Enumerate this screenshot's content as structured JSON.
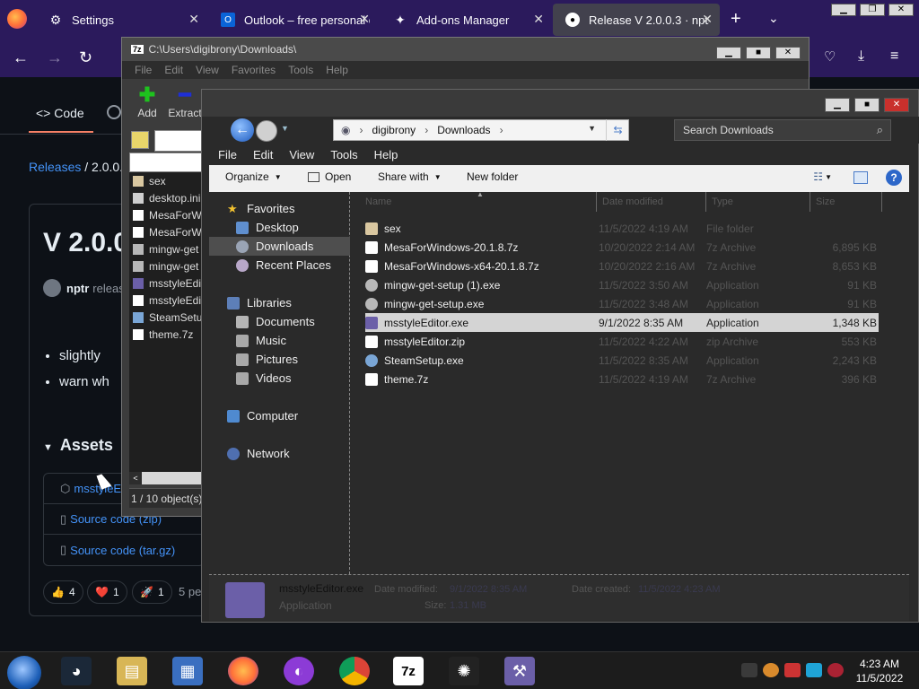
{
  "firefox": {
    "tabs": [
      {
        "label": "Settings",
        "icon": "gear-icon"
      },
      {
        "label": "Outlook – free personal e",
        "icon": "outlook-icon"
      },
      {
        "label": "Add-ons Manager",
        "icon": "puzzle-icon"
      },
      {
        "label": "Release V 2.0.0.3 · nptr/m",
        "icon": "github-icon"
      }
    ],
    "new_tab": "+",
    "list_tabs": "⌄"
  },
  "github": {
    "code_tab": "Code",
    "breadcrumb_link": "Releases",
    "breadcrumb_rest": "/ 2.0.0.3",
    "release_title": "V 2.0.0",
    "author": "nptr",
    "author_suffix": "releas",
    "bullets": [
      "slightly",
      "warn wh"
    ],
    "assets_heading": "Assets",
    "assets": [
      "msstyleE",
      "Source code (zip)",
      "Source code (tar.gz)"
    ],
    "reactions": [
      {
        "emoji": "👍",
        "count": "4"
      },
      {
        "emoji": "❤️",
        "count": "1"
      },
      {
        "emoji": "🚀",
        "count": "1"
      }
    ],
    "people": "5 pe"
  },
  "sevenzip": {
    "title": "C:\\Users\\digibrony\\Downloads\\",
    "menu": [
      "File",
      "Edit",
      "View",
      "Favorites",
      "Tools",
      "Help"
    ],
    "tools": [
      "Add",
      "Extract"
    ],
    "items": [
      "sex",
      "desktop.ini",
      "MesaForW",
      "MesaForW",
      "mingw-get",
      "mingw-get",
      "msstyleEdi",
      "msstyleEdi",
      "SteamSetu",
      "theme.7z"
    ],
    "status": "1 / 10 object(s)"
  },
  "explorer": {
    "address": [
      "digibrony",
      "Downloads"
    ],
    "search_placeholder": "Search Downloads",
    "menu": [
      "File",
      "Edit",
      "View",
      "Tools",
      "Help"
    ],
    "commands": {
      "organize": "Organize",
      "open": "Open",
      "share": "Share with",
      "new_folder": "New folder"
    },
    "nav": {
      "favorites": "Favorites",
      "desktop": "Desktop",
      "downloads": "Downloads",
      "recent": "Recent Places",
      "libraries": "Libraries",
      "documents": "Documents",
      "music": "Music",
      "pictures": "Pictures",
      "videos": "Videos",
      "computer": "Computer",
      "network": "Network"
    },
    "columns": [
      "Name",
      "Date modified",
      "Type",
      "Size"
    ],
    "files": [
      {
        "name": "sex",
        "date": "11/5/2022 4:19 AM",
        "type": "File folder",
        "size": ""
      },
      {
        "name": "MesaForWindows-20.1.8.7z",
        "date": "10/20/2022 2:14 AM",
        "type": "7z Archive",
        "size": "6,895 KB"
      },
      {
        "name": "MesaForWindows-x64-20.1.8.7z",
        "date": "10/20/2022 2:16 AM",
        "type": "7z Archive",
        "size": "8,653 KB"
      },
      {
        "name": "mingw-get-setup (1).exe",
        "date": "11/5/2022 3:50 AM",
        "type": "Application",
        "size": "91 KB"
      },
      {
        "name": "mingw-get-setup.exe",
        "date": "11/5/2022 3:48 AM",
        "type": "Application",
        "size": "91 KB"
      },
      {
        "name": "msstyleEditor.exe",
        "date": "9/1/2022 8:35 AM",
        "type": "Application",
        "size": "1,348 KB"
      },
      {
        "name": "msstyleEditor.zip",
        "date": "11/5/2022 4:22 AM",
        "type": "zip Archive",
        "size": "553 KB"
      },
      {
        "name": "SteamSetup.exe",
        "date": "11/5/2022 8:35 AM",
        "type": "Application",
        "size": "2,243 KB"
      },
      {
        "name": "theme.7z",
        "date": "11/5/2022 4:19 AM",
        "type": "7z Archive",
        "size": "396 KB"
      }
    ],
    "details": {
      "name": "msstyleEditor.exe",
      "type": "Application",
      "date_modified_label": "Date modified:",
      "date_modified": "9/1/2022 8:35 AM",
      "date_created_label": "Date created:",
      "date_created": "11/5/2022 4:23 AM",
      "size_label": "Size:",
      "size": "1.31 MB"
    }
  },
  "taskbar": {
    "time": "4:23 AM",
    "date": "11/5/2022"
  }
}
